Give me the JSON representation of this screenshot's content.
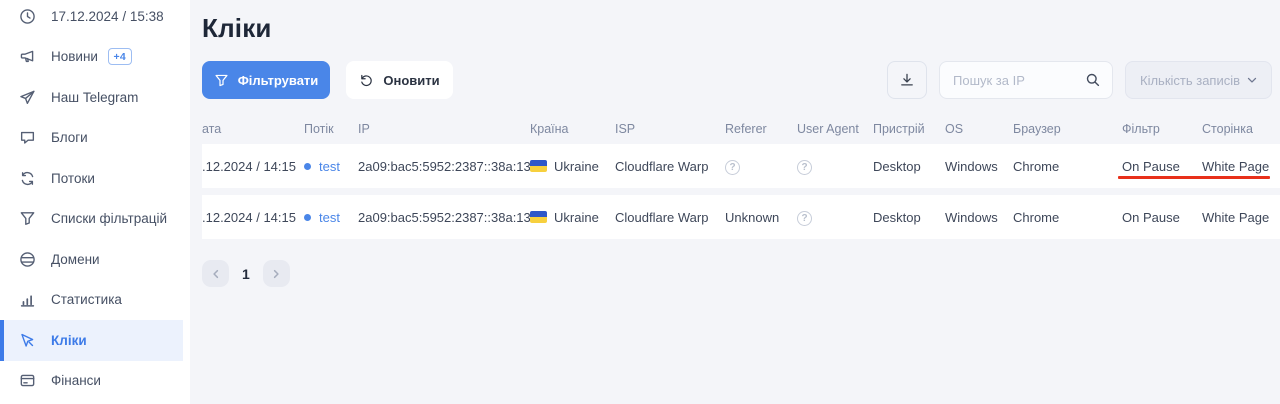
{
  "sidebar": {
    "items": [
      {
        "label": "17.12.2024 / 15:38",
        "icon": "clock-icon"
      },
      {
        "label": "Новини",
        "icon": "megaphone-icon",
        "badge": "+4"
      },
      {
        "label": "Наш Telegram",
        "icon": "paper-plane-icon"
      },
      {
        "label": "Блоги",
        "icon": "chat-icon"
      },
      {
        "label": "Потоки",
        "icon": "sync-icon"
      },
      {
        "label": "Списки фільтрацій",
        "icon": "funnel-icon"
      },
      {
        "label": "Домени",
        "icon": "globe-icon"
      },
      {
        "label": "Статистика",
        "icon": "bar-chart-icon"
      },
      {
        "label": "Кліки",
        "icon": "cursor-icon",
        "active": true
      },
      {
        "label": "Фінанси",
        "icon": "card-icon"
      }
    ]
  },
  "header": {
    "title": "Кліки"
  },
  "toolbar": {
    "filter_label": "Фільтрувати",
    "filter_icon": "funnel-icon",
    "refresh_label": "Оновити",
    "refresh_icon": "refresh-icon",
    "download_icon": "download-icon",
    "search_placeholder": "Пошук за IP",
    "search_icon": "search-icon",
    "records_label": "Кількість записів",
    "records_chevron_icon": "chevron-down-icon"
  },
  "table": {
    "headers": [
      "ата",
      "Потік",
      "IP",
      "Країна",
      "ISP",
      "Referer",
      "User Agent",
      "Пристрій",
      "OS",
      "Браузер",
      "Фільтр",
      "Сторінка"
    ],
    "rows": [
      {
        "date": ".12.2024 / 14:15",
        "flow": "test",
        "ip": "2a09:bac5:5952:2387::38a:13",
        "country": "Ukraine",
        "country_flag_icon": "ukraine-flag-icon",
        "isp": "Cloudflare Warp",
        "referer_icon": "question-icon",
        "user_agent_icon": "question-icon",
        "device": "Desktop",
        "os": "Windows",
        "browser": "Chrome",
        "filter": "On Pause",
        "page": "White Page",
        "red_underline_annotation": true
      },
      {
        "date": ".12.2024 / 14:15",
        "flow": "test",
        "ip": "2a09:bac5:5952:2387::38a:13",
        "country": "Ukraine",
        "country_flag_icon": "ukraine-flag-icon",
        "isp": "Cloudflare Warp",
        "referer": "Unknown",
        "user_agent_icon": "question-icon",
        "device": "Desktop",
        "os": "Windows",
        "browser": "Chrome",
        "filter": "On Pause",
        "page": "White Page",
        "red_underline_annotation": false
      }
    ]
  },
  "pagination": {
    "prev_icon": "chevron-left-icon",
    "current_page": "1",
    "next_icon": "chevron-right-icon"
  },
  "colors": {
    "accent_blue": "#4a86e8",
    "active_item_bg": "#ecf2fd",
    "page_bg": "#f4f5f9",
    "annotation_red": "#e8301a",
    "flag_blue": "#2e57c9",
    "flag_yellow": "#f7d03e"
  }
}
